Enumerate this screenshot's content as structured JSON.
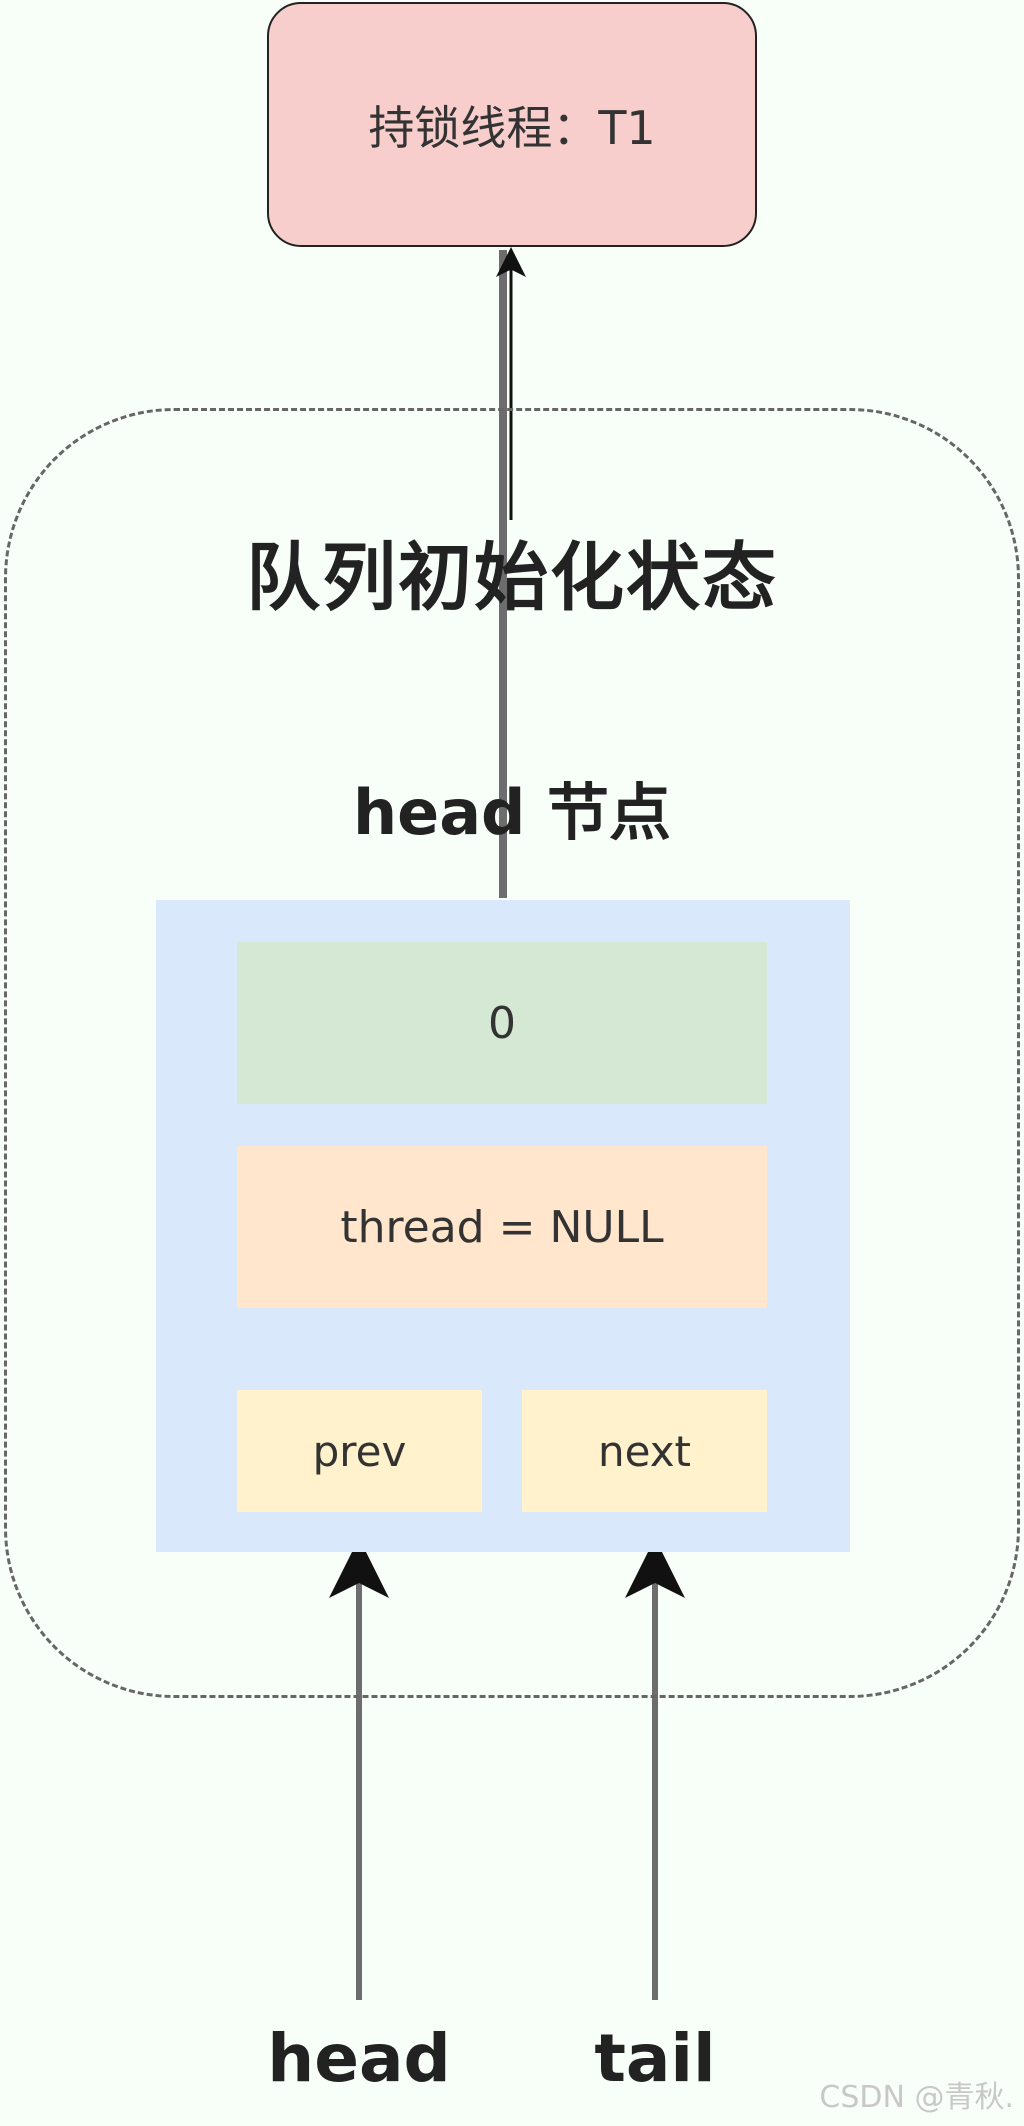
{
  "lock_holder": {
    "label": "持锁线程：T1",
    "fill": "#f8cecc"
  },
  "queue": {
    "title": "队列初始化状态"
  },
  "head_node": {
    "title": "head 节点",
    "fill": "#dae8fc",
    "state_value": "0",
    "state_fill": "#d5e8d4",
    "thread_field": "thread = NULL",
    "thread_fill": "#ffe6cc",
    "prev_label": "prev",
    "next_label": "next",
    "pointer_fill": "#fff2cc"
  },
  "pointers": {
    "head_label": "head",
    "tail_label": "tail"
  },
  "watermark": "CSDN @青秋."
}
